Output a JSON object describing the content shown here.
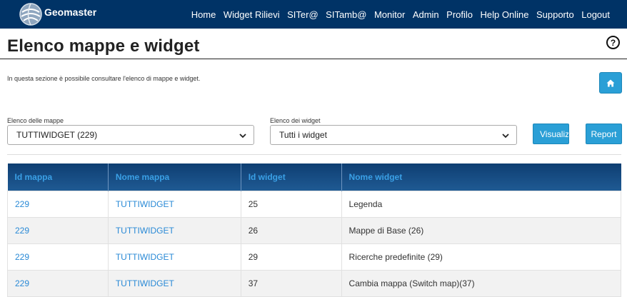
{
  "app": {
    "brand": "Geomaster"
  },
  "nav": [
    "Home",
    "Widget Rilievi",
    "SITer@",
    "SITamb@",
    "Monitor",
    "Admin",
    "Profilo",
    "Help Online",
    "Supporto",
    "Logout"
  ],
  "page": {
    "title": "Elenco mappe e widget",
    "help": "?",
    "intro": "In questa sezione è possibile consultare l'elenco di mappe e widget."
  },
  "filters": {
    "maps_label": "Elenco delle mappe",
    "maps_value": "TUTTIWIDGET (229)",
    "widgets_label": "Elenco dei widget",
    "widgets_value": "Tutti i widget"
  },
  "buttons": {
    "show": "Visualizza",
    "report": "Report"
  },
  "table": {
    "headers": [
      "Id mappa",
      "Nome mappa",
      "Id widget",
      "Nome widget"
    ],
    "rows": [
      [
        "229",
        "TUTTIWIDGET",
        "25",
        "Legenda"
      ],
      [
        "229",
        "TUTTIWIDGET",
        "26",
        "Mappe di Base (26)"
      ],
      [
        "229",
        "TUTTIWIDGET",
        "29",
        "Ricerche predefinite (29)"
      ],
      [
        "229",
        "TUTTIWIDGET",
        "37",
        "Cambia mappa (Switch map)(37)"
      ]
    ]
  },
  "icons": {
    "home": "home-icon",
    "help": "help-icon",
    "logo": "globe-logo-icon",
    "dropdown": "chevron-down-icon"
  },
  "colors": {
    "navbar": "#003366",
    "accent": "#2a9fd6",
    "link": "#2a8ad6",
    "table_header": "#0e3e72"
  }
}
